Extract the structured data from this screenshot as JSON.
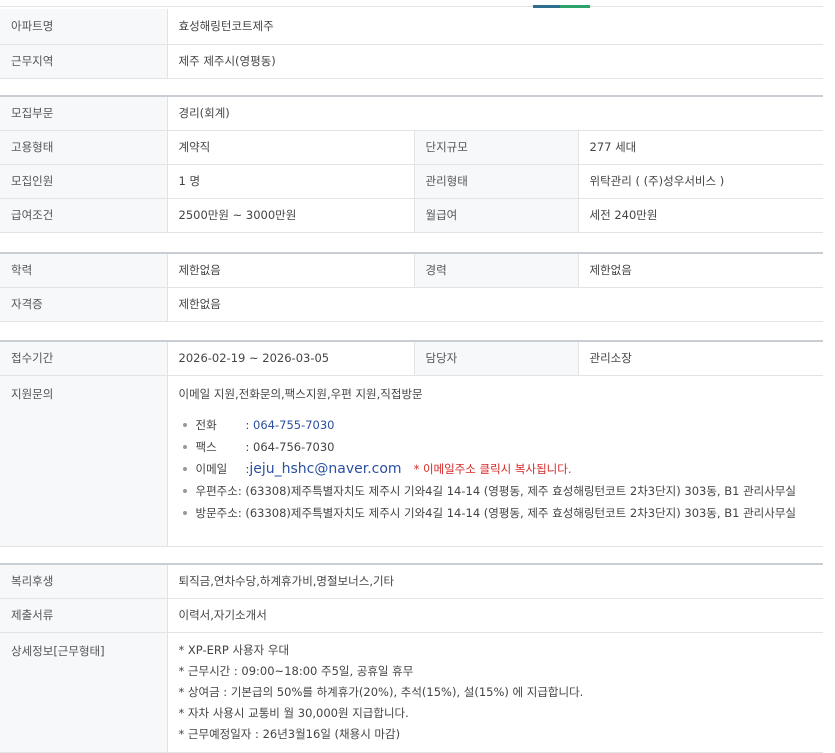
{
  "apt": {
    "name_label": "아파트명",
    "name_value": "효성해링턴코트제주",
    "region_label": "근무지역",
    "region_value": "제주 제주시(영평동)"
  },
  "job": {
    "dept_label": "모집부문",
    "dept_value": "경리(회계)",
    "emp_label": "고용형태",
    "emp_value": "계약직",
    "size_label": "단지규모",
    "size_value": "277 세대",
    "count_label": "모집인원",
    "count_value": "1 명",
    "mgmt_label": "관리형태",
    "mgmt_value": "위탁관리 ( (주)성우서비스 )",
    "salary_label": "급여조건",
    "salary_value": "2500만원 ~ 3000만원",
    "monthly_label": "월급여",
    "monthly_value": "세전 240만원"
  },
  "qual": {
    "edu_label": "학력",
    "edu_value": "제한없음",
    "exp_label": "경력",
    "exp_value": "제한없음",
    "cert_label": "자격증",
    "cert_value": "제한없음"
  },
  "apply": {
    "period_label": "접수기간",
    "period_value": "2026-02-19 ~ 2026-03-05",
    "contact_label": "담당자",
    "contact_value": "관리소장",
    "inquiry_label": "지원문의",
    "inquiry_methods": "이메일 지원,전화문의,팩스지원,우편 지원,직접방문",
    "phone_label": "전화",
    "phone_value": ": 064-755-7030",
    "fax_label": "팩스",
    "fax_value": ": 064-756-7030",
    "email_label": "이메일",
    "email_sep": ":",
    "email_value": "jeju_hshc@naver.com",
    "email_note": "* 이메일주소 클릭시 복사됩니다.",
    "post_label": "우편주소",
    "post_value": ": (63308)제주특별자치도 제주시 기와4길 14-14 (영평동, 제주 효성해링턴코트 2차3단지) 303동, B1 관리사무실",
    "visit_label": "방문주소",
    "visit_value": ": (63308)제주특별자치도 제주시 기와4길 14-14 (영평동, 제주 효성해링턴코트 2차3단지) 303동, B1 관리사무실"
  },
  "extra": {
    "welfare_label": "복리후생",
    "welfare_value": "퇴직금,연차수당,하계휴가비,명절보너스,기타",
    "docs_label": "제출서류",
    "docs_value": "이력서,자기소개서",
    "detail_label": "상세정보[근무형태]",
    "detail_lines": [
      "* XP-ERP 사용자 우대",
      "* 근무시간 : 09:00~18:00 주5일, 공휴일 휴무",
      "* 상여금 : 기본급의 50%를 하계휴가(20%), 추석(15%), 설(15%) 에 지급합니다.",
      "* 자차 사용시 교통비 월 30,000원 지급합니다.",
      "* 근무예정일자 : 26년3월16일 (채용시 마감)"
    ]
  }
}
